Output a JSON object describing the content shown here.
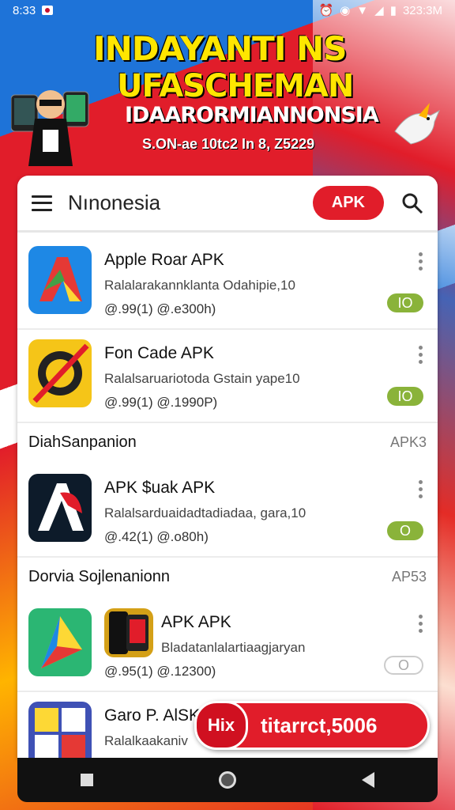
{
  "status": {
    "time": "8:33",
    "right_text": "323:3M"
  },
  "banner": {
    "title_line1": "INDAYANTI NS",
    "title_line2": "UFASCHEMAN",
    "subtitle": "IDAARORMIANNONSIA",
    "date_line": "S.ON-ae 10tc2 In 8, Z5229"
  },
  "topbar": {
    "title": "Nınonesia",
    "apk_pill": "APK"
  },
  "rows": [
    {
      "title": "Apple Roar APK",
      "desc": "Ralalarakannklanta Odahipie,10",
      "meta": "@.99(1) @.e300h)",
      "toggle": "IO"
    },
    {
      "title": "Fon Cade APK",
      "desc": "Ralalsaruariotoda Gstain yape10",
      "meta": "@.99(1) @.1990P)",
      "toggle": "IO"
    },
    {
      "title": "APK $uak APK",
      "desc": "Ralalsarduaidadtadiadaa, gara,10",
      "meta": "@.42(1) @.o80h)",
      "toggle": "O"
    },
    {
      "title": "APK APK",
      "desc": "Bladatanlalartiaagjaryan",
      "meta": "@.95(1) @.12300)",
      "toggle": "O"
    },
    {
      "title": "Garo P. AlSK",
      "desc": "Ralalkaakaniv"
    }
  ],
  "sections": [
    {
      "title": "DiahSanpanion",
      "count": "APK3"
    },
    {
      "title": "Dorvia Sojlenanionn",
      "count": "AP53"
    }
  ],
  "float_button": {
    "circle": "Hix",
    "label": "titarrct,5006"
  },
  "colors": {
    "accent": "#e11d2a",
    "toggle_on": "#8ab33a",
    "title_yellow": "#ffe600"
  }
}
